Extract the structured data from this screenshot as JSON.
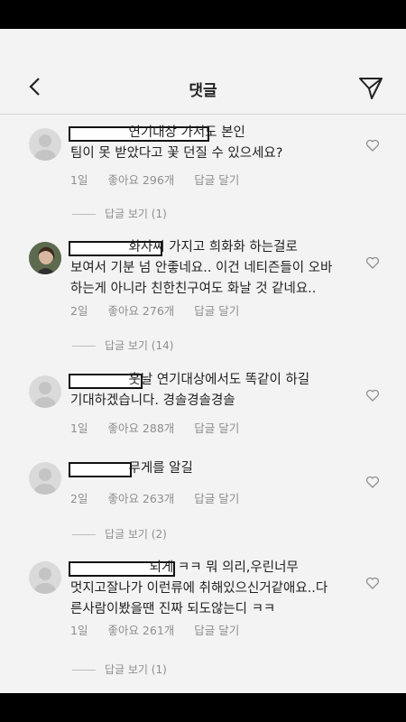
{
  "header": {
    "title": "댓글",
    "back_icon": "chevron-left-icon",
    "send_icon": "paper-plane-icon"
  },
  "comments": [
    {
      "text": "              연기대상 가서도 본인\n팀이 못 받았다고 꽃 던질 수 있으세요?",
      "time": "1일",
      "likes": "좋아요 296개",
      "reply": "답글 달기",
      "view_replies": "답글 보기 (1)"
    },
    {
      "text": "              화사씨 가지고 희화화 하는걸로\n보여서 기분 넘 안좋네요.. 이건 네티즌들이 오바\n하는게 아니라 친한친구여도 화날 것 같네요..",
      "time": "2일",
      "likes": "좋아요 276개",
      "reply": "답글 달기",
      "view_replies": "답글 보기 (14)"
    },
    {
      "text": "              훗날 연기대상에서도 똑같이 하길\n기대하겠습니다. 경솔경솔경솔",
      "time": "1일",
      "likes": "좋아요 288개",
      "reply": "답글 달기",
      "view_replies": ""
    },
    {
      "text": "              무게를 알길",
      "time": "2일",
      "likes": "좋아요 263개",
      "reply": "답글 달기",
      "view_replies": "답글 보기 (2)"
    },
    {
      "text": "                   되게 ㅋㅋ 뭐 의리,우린너무\n멋지고잘나가 이런류에 취해있으신거같애요..다\n른사람이봤을땐 진짜 되도않는디 ㅋㅋ",
      "time": "1일",
      "likes": "좋아요 261개",
      "reply": "답글 달기",
      "view_replies": "답글 보기 (1)"
    }
  ]
}
